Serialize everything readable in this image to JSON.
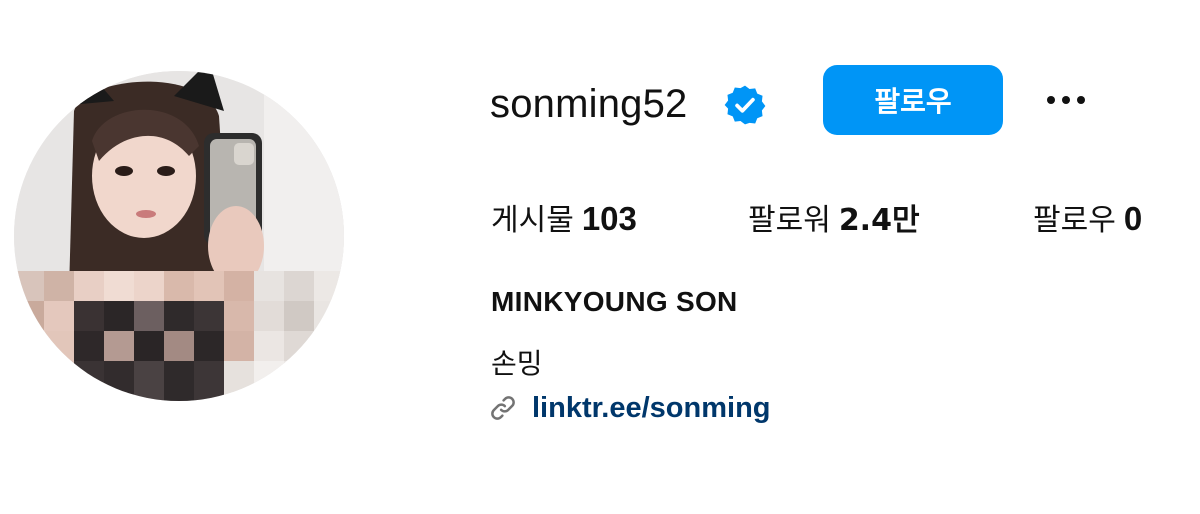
{
  "profile": {
    "username": "sonming52",
    "verified_badge_icon": "verified-badge-icon",
    "follow_button_label": "팔로우",
    "more_icon": "more-horizontal-icon",
    "stats": {
      "posts_label": "게시물",
      "posts_count": "103",
      "followers_label": "팔로워",
      "followers_count": "2.4만",
      "following_label": "팔로우",
      "following_count": "0"
    },
    "full_name": "MINKYOUNG SON",
    "bio": "손밍",
    "link_icon": "link-icon",
    "link_text": "linktr.ee/sonming"
  },
  "colors": {
    "accent": "#0095f6",
    "link": "#00376b",
    "text": "#111111",
    "background": "#ffffff"
  }
}
